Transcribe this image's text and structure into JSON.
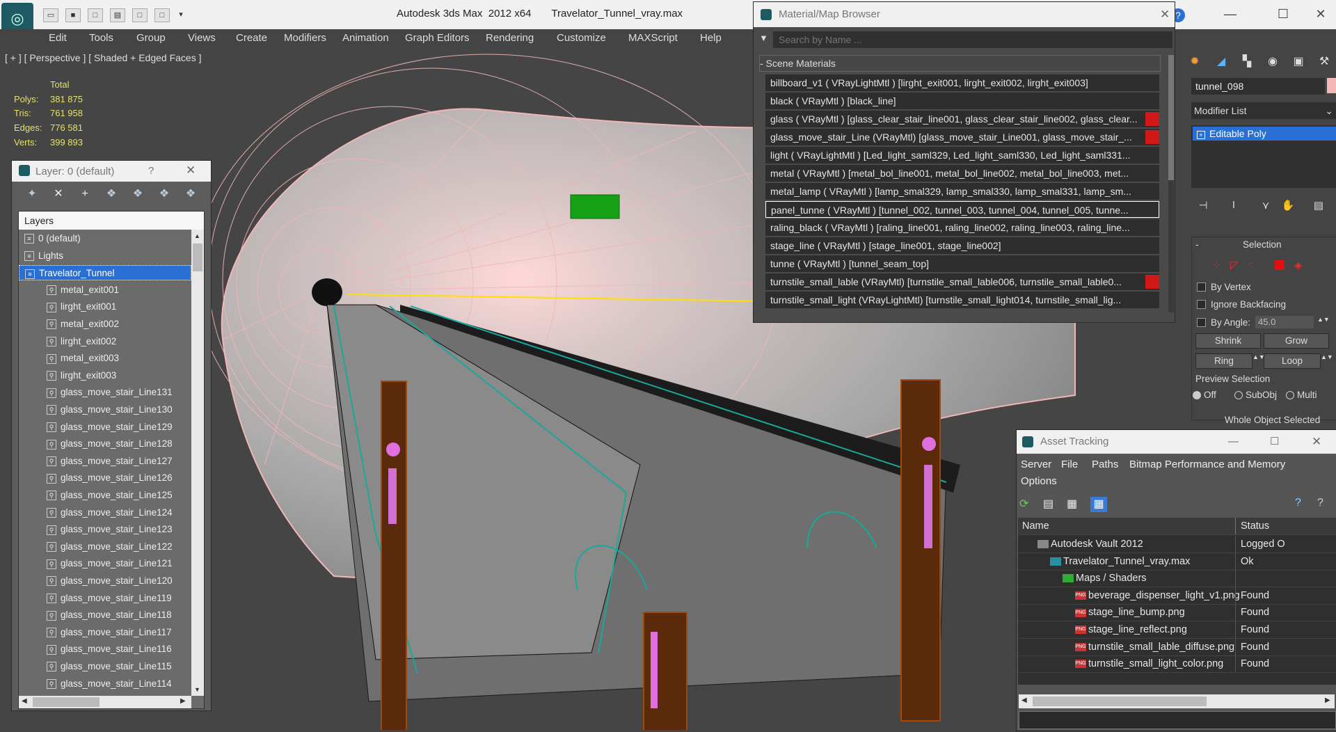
{
  "window": {
    "title": "Autodesk 3ds Max  2012 x64       Travelator_Tunnel_vray.max",
    "controls": [
      "—",
      "☐",
      "✕"
    ],
    "help_icon": "?"
  },
  "menu": [
    "Edit",
    "Tools",
    "Group",
    "Views",
    "Create",
    "Modifiers",
    "Animation",
    "Graph Editors",
    "Rendering",
    "Customize",
    "MAXScript",
    "Help"
  ],
  "viewport": {
    "label": "[ + ] [ Perspective ] [ Shaded + Edged Faces ]",
    "stats": {
      "total_label": "Total",
      "rows": [
        {
          "label": "Polys:",
          "value": "381 875"
        },
        {
          "label": "Tris:",
          "value": "761 958"
        },
        {
          "label": "Edges:",
          "value": "776 581"
        },
        {
          "label": "Verts:",
          "value": "399 893"
        }
      ]
    }
  },
  "layer_panel": {
    "title": "Layer: 0 (default)",
    "help": "?",
    "close": "✕",
    "heading": "Layers",
    "rows": [
      {
        "label": "0 (default)",
        "kind": "layer"
      },
      {
        "label": "Lights",
        "kind": "layer"
      },
      {
        "label": "Travelator_Tunnel",
        "kind": "layer-selected"
      },
      {
        "label": "metal_exit001",
        "kind": "object"
      },
      {
        "label": "lirght_exit001",
        "kind": "object"
      },
      {
        "label": "metal_exit002",
        "kind": "object"
      },
      {
        "label": "lirght_exit002",
        "kind": "object"
      },
      {
        "label": "metal_exit003",
        "kind": "object"
      },
      {
        "label": "lirght_exit003",
        "kind": "object"
      },
      {
        "label": "glass_move_stair_Line131",
        "kind": "object"
      },
      {
        "label": "glass_move_stair_Line130",
        "kind": "object"
      },
      {
        "label": "glass_move_stair_Line129",
        "kind": "object"
      },
      {
        "label": "glass_move_stair_Line128",
        "kind": "object"
      },
      {
        "label": "glass_move_stair_Line127",
        "kind": "object"
      },
      {
        "label": "glass_move_stair_Line126",
        "kind": "object"
      },
      {
        "label": "glass_move_stair_Line125",
        "kind": "object"
      },
      {
        "label": "glass_move_stair_Line124",
        "kind": "object"
      },
      {
        "label": "glass_move_stair_Line123",
        "kind": "object"
      },
      {
        "label": "glass_move_stair_Line122",
        "kind": "object"
      },
      {
        "label": "glass_move_stair_Line121",
        "kind": "object"
      },
      {
        "label": "glass_move_stair_Line120",
        "kind": "object"
      },
      {
        "label": "glass_move_stair_Line119",
        "kind": "object"
      },
      {
        "label": "glass_move_stair_Line118",
        "kind": "object"
      },
      {
        "label": "glass_move_stair_Line117",
        "kind": "object"
      },
      {
        "label": "glass_move_stair_Line116",
        "kind": "object"
      },
      {
        "label": "glass_move_stair_Line115",
        "kind": "object"
      },
      {
        "label": "glass_move_stair_Line114",
        "kind": "object"
      }
    ]
  },
  "material_browser": {
    "title": "Material/Map Browser",
    "search_placeholder": "Search by Name ...",
    "section": "- Scene Materials",
    "rows": [
      {
        "text": "billboard_v1  ( VRayLightMtl ) [lirght_exit001, lirght_exit002, lirght_exit003]",
        "red": false
      },
      {
        "text": "black  ( VRayMtl ) [black_line]",
        "red": false
      },
      {
        "text": "glass ( VRayMtl ) [glass_clear_stair_line001, glass_clear_stair_line002, glass_clear...",
        "red": true
      },
      {
        "text": "glass_move_stair_Line (VRayMtl) [glass_move_stair_Line001, glass_move_stair_...",
        "red": true
      },
      {
        "text": "light ( VRayLightMtl ) [Led_light_saml329, Led_light_saml330, Led_light_saml331...",
        "red": false
      },
      {
        "text": "metal  ( VRayMtl ) [metal_bol_line001, metal_bol_line002, metal_bol_line003, met...",
        "red": false
      },
      {
        "text": "metal_lamp  ( VRayMtl ) [lamp_smal329, lamp_smal330, lamp_smal331, lamp_sm...",
        "red": false
      },
      {
        "text": "panel_tunne  ( VRayMtl )  [tunnel_002, tunnel_003, tunnel_004, tunnel_005, tunne...",
        "red": false,
        "selected": true
      },
      {
        "text": "raling_black  ( VRayMtl ) [raling_line001, raling_line002, raling_line003, raling_line...",
        "red": false
      },
      {
        "text": "stage_line  ( VRayMtl ) [stage_line001, stage_line002]",
        "red": false
      },
      {
        "text": "tunne  ( VRayMtl ) [tunnel_seam_top]",
        "red": false
      },
      {
        "text": "turnstile_small_lable (VRayMtl) [turnstile_small_lable006, turnstile_small_lable0...",
        "red": true
      },
      {
        "text": "turnstile_small_light (VRayLightMtl) [turnstile_small_light014, turnstile_small_lig...",
        "red": false
      }
    ]
  },
  "command_panel": {
    "object_name": "tunnel_098",
    "modifier_list": "Modifier List",
    "stack_item": "Editable Poly",
    "selection_title": "Selection",
    "by_vertex": "By Vertex",
    "ignore_backfacing": "Ignore Backfacing",
    "by_angle": "By Angle:",
    "angle_value": "45.0",
    "shrink": "Shrink",
    "grow": "Grow",
    "ring": "Ring",
    "loop": "Loop",
    "preview_selection": "Preview Selection",
    "preview_off": "Off",
    "preview_subobj": "SubObj",
    "preview_multi": "Multi",
    "whole_object": "Whole Object Selected"
  },
  "asset_tracking": {
    "title": "Asset Tracking",
    "menu": [
      "Server",
      "File",
      "Paths",
      "Bitmap Performance and Memory",
      "Options"
    ],
    "columns": [
      "Name",
      "Status"
    ],
    "rows": [
      {
        "name": "Autodesk Vault 2012",
        "status": "Logged O",
        "indent": 1
      },
      {
        "name": "Travelator_Tunnel_vray.max",
        "status": "Ok",
        "indent": 2
      },
      {
        "name": "Maps / Shaders",
        "status": "",
        "indent": 3
      },
      {
        "name": "beverage_dispenser_light_v1.png",
        "status": "Found",
        "indent": 4
      },
      {
        "name": "stage_line_bump.png",
        "status": "Found",
        "indent": 4
      },
      {
        "name": "stage_line_reflect.png",
        "status": "Found",
        "indent": 4
      },
      {
        "name": "turnstile_small_lable_diffuse.png",
        "status": "Found",
        "indent": 4
      },
      {
        "name": "turnstile_small_light_color.png",
        "status": "Found",
        "indent": 4
      }
    ]
  },
  "colors": {
    "accent_selected": "#2a6fd3",
    "wire_pink": "#f2b6b6",
    "wire_teal": "#17a99a",
    "wire_orange": "#a04a10",
    "stat_yellow": "#e8e06a"
  }
}
